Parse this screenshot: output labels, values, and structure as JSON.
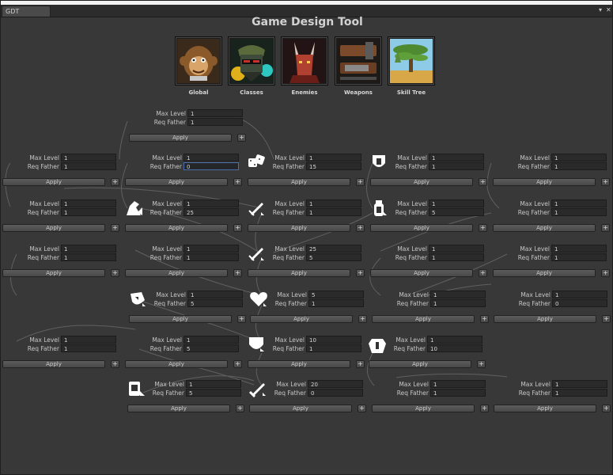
{
  "window": {
    "tab_label": "GDT",
    "title": "Game Design Tool"
  },
  "categories": [
    {
      "label": "Global",
      "icon": "monkey-portrait-icon"
    },
    {
      "label": "Classes",
      "icon": "masked-soldier-icon"
    },
    {
      "label": "Enemies",
      "icon": "horned-creature-icon"
    },
    {
      "label": "Weapons",
      "icon": "gun-icon"
    },
    {
      "label": "Skill Tree",
      "icon": "tree-landscape-icon"
    }
  ],
  "field_labels": {
    "max_level": "Max Level",
    "req_father": "Req Father",
    "apply": "Apply",
    "add": "+"
  },
  "nodes": [
    {
      "max_level": "1",
      "req_father": "1",
      "icon": ""
    },
    {
      "max_level": "1",
      "req_father": "1",
      "icon": ""
    },
    {
      "max_level": "1",
      "req_father": "0",
      "icon": ""
    },
    {
      "max_level": "1",
      "req_father": "15",
      "icon": "dice-icon"
    },
    {
      "max_level": "1",
      "req_father": "1",
      "icon": "shield-emblem-icon"
    },
    {
      "max_level": "1",
      "req_father": "1",
      "icon": ""
    },
    {
      "max_level": "1",
      "req_father": "1",
      "icon": ""
    },
    {
      "max_level": "1",
      "req_father": "25",
      "icon": "horse-helmet-icon"
    },
    {
      "max_level": "1",
      "req_father": "1",
      "icon": "sword-upgrade-icon"
    },
    {
      "max_level": "1",
      "req_father": "5",
      "icon": "potion-icon"
    },
    {
      "max_level": "1",
      "req_father": "1",
      "icon": ""
    },
    {
      "max_level": "1",
      "req_father": "1",
      "icon": ""
    },
    {
      "max_level": "1",
      "req_father": "1",
      "icon": ""
    },
    {
      "max_level": "25",
      "req_father": "5",
      "icon": "sword-upgrade-icon"
    },
    {
      "max_level": "1",
      "req_father": "1",
      "icon": ""
    },
    {
      "max_level": "1",
      "req_father": "1",
      "icon": ""
    },
    {
      "max_level": "1",
      "req_father": "5",
      "icon": "shield-up-icon"
    },
    {
      "max_level": "5",
      "req_father": "1",
      "icon": "heart-icon"
    },
    {
      "max_level": "1",
      "req_father": "1",
      "icon": ""
    },
    {
      "max_level": "1",
      "req_father": "0",
      "icon": ""
    },
    {
      "max_level": "1",
      "req_father": "1",
      "icon": ""
    },
    {
      "max_level": "1",
      "req_father": "5",
      "icon": ""
    },
    {
      "max_level": "10",
      "req_father": "1",
      "icon": "shield-icon"
    },
    {
      "max_level": "1",
      "req_father": "10",
      "icon": "armor-icon"
    },
    {
      "max_level": "1",
      "req_father": "5",
      "icon": "book-upgrade-icon"
    },
    {
      "max_level": "20",
      "req_father": "0",
      "icon": "sword-icon"
    },
    {
      "max_level": "1",
      "req_father": "1",
      "icon": ""
    },
    {
      "max_level": "1",
      "req_father": "1",
      "icon": ""
    }
  ],
  "colors": {
    "background": "#383838",
    "panel_text": "#c6c6c6",
    "input_bg": "#2a2a2a",
    "focus_border": "#4c6ea8"
  }
}
